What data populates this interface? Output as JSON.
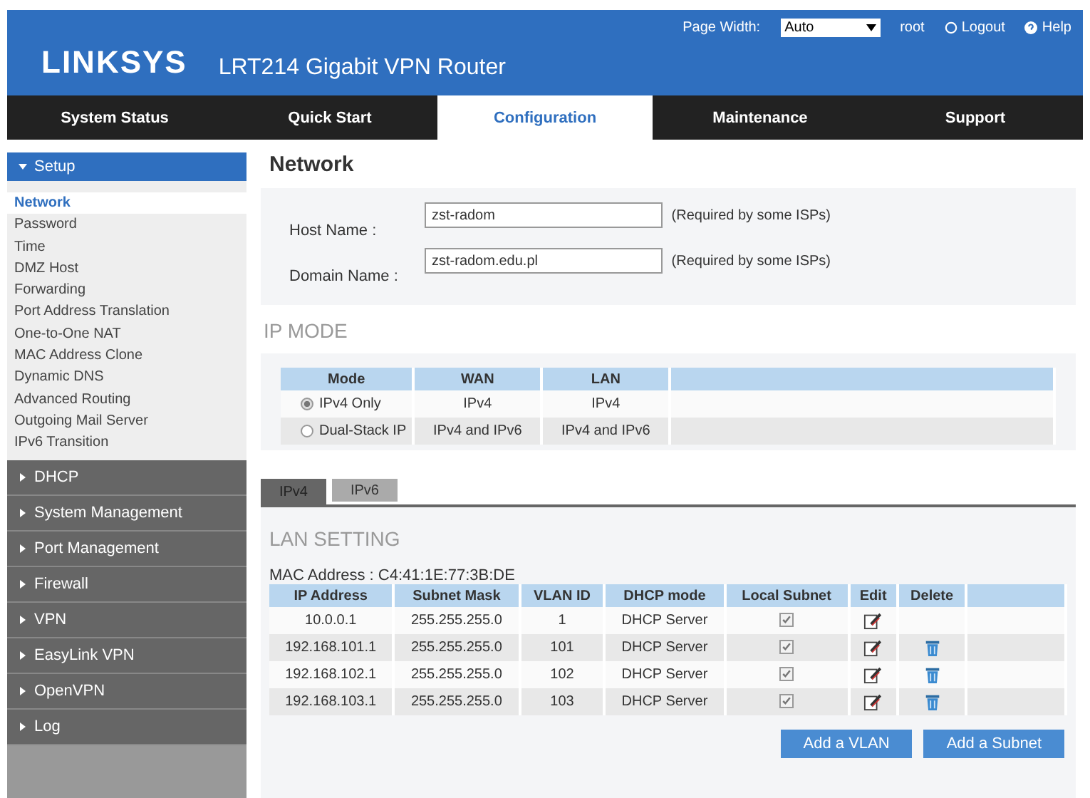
{
  "header": {
    "logo": "LINKSYS",
    "product": "LRT214  Gigabit VPN Router",
    "page_width_label": "Page Width:",
    "page_width_value": "Auto",
    "user": "root",
    "logout": "Logout",
    "help": "Help"
  },
  "nav": [
    {
      "label": "System Status",
      "selected": false
    },
    {
      "label": "Quick Start",
      "selected": false
    },
    {
      "label": "Configuration",
      "selected": true
    },
    {
      "label": "Maintenance",
      "selected": false
    },
    {
      "label": "Support",
      "selected": false
    }
  ],
  "sidebar": {
    "sections": [
      {
        "label": "Setup",
        "expanded": true,
        "children": [
          {
            "label": "Network",
            "selected": true
          },
          {
            "label": "Password",
            "selected": false
          },
          {
            "label": "Time",
            "selected": false
          },
          {
            "label": "DMZ Host",
            "selected": false
          },
          {
            "label": "Forwarding",
            "selected": false
          },
          {
            "label": "Port Address Translation",
            "selected": false
          },
          {
            "label": "One-to-One NAT",
            "selected": false
          },
          {
            "label": "MAC Address Clone",
            "selected": false
          },
          {
            "label": "Dynamic DNS",
            "selected": false
          },
          {
            "label": "Advanced Routing",
            "selected": false
          },
          {
            "label": "Outgoing Mail Server",
            "selected": false
          },
          {
            "label": "IPv6 Transition",
            "selected": false
          }
        ]
      },
      {
        "label": "DHCP",
        "expanded": false
      },
      {
        "label": "System Management",
        "expanded": false
      },
      {
        "label": "Port Management",
        "expanded": false
      },
      {
        "label": "Firewall",
        "expanded": false
      },
      {
        "label": "VPN",
        "expanded": false
      },
      {
        "label": "EasyLink VPN",
        "expanded": false
      },
      {
        "label": "OpenVPN",
        "expanded": false
      },
      {
        "label": "Log",
        "expanded": false
      }
    ]
  },
  "page_title": "Network",
  "form": [
    {
      "label": "Host Name :",
      "value": "zst-radom",
      "note": "(Required by some ISPs)"
    },
    {
      "label": "Domain Name :",
      "value": "zst-radom.edu.pl",
      "note": "(Required by some ISPs)"
    }
  ],
  "ip_mode": {
    "title": "IP MODE",
    "columns": [
      "Mode",
      "WAN",
      "LAN"
    ],
    "rows": [
      {
        "mode": "IPv4 Only",
        "wan": "IPv4",
        "lan": "IPv4",
        "selected": true
      },
      {
        "mode": "Dual-Stack IP",
        "wan": "IPv4 and IPv6",
        "lan": "IPv4 and IPv6",
        "selected": false
      }
    ]
  },
  "tabs": [
    {
      "label": "IPv4",
      "selected": true
    },
    {
      "label": "IPv6",
      "selected": false
    }
  ],
  "lan": {
    "title": "LAN SETTING",
    "mac": "MAC Address : C4:41:1E:77:3B:DE",
    "columns": [
      "IP Address",
      "Subnet Mask",
      "VLAN ID",
      "DHCP mode",
      "Local Subnet",
      "Edit",
      "Delete"
    ],
    "rows": [
      {
        "ip": "10.0.0.1",
        "mask": "255.255.255.0",
        "vlan": "1",
        "dhcp": "DHCP Server",
        "local_subnet": true,
        "deletable": false
      },
      {
        "ip": "192.168.101.1",
        "mask": "255.255.255.0",
        "vlan": "101",
        "dhcp": "DHCP Server",
        "local_subnet": true,
        "deletable": true
      },
      {
        "ip": "192.168.102.1",
        "mask": "255.255.255.0",
        "vlan": "102",
        "dhcp": "DHCP Server",
        "local_subnet": true,
        "deletable": true
      },
      {
        "ip": "192.168.103.1",
        "mask": "255.255.255.0",
        "vlan": "103",
        "dhcp": "DHCP Server",
        "local_subnet": true,
        "deletable": true
      }
    ],
    "buttons": [
      "Add a VLAN",
      "Add a Subnet"
    ]
  }
}
